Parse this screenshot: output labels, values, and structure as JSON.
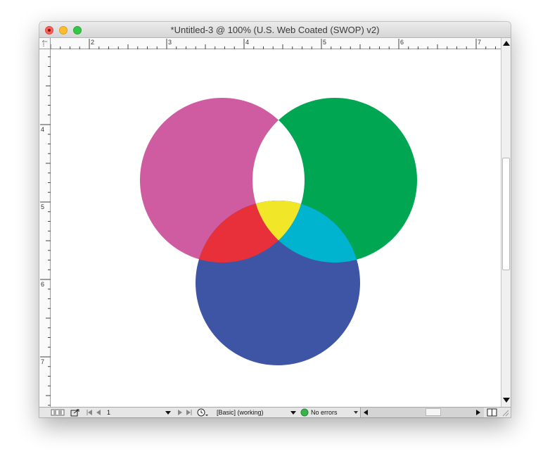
{
  "window": {
    "title": "*Untitled-3 @ 100% (U.S. Web Coated (SWOP) v2)"
  },
  "rulers": {
    "horizontal_labels": [
      "2",
      "3",
      "4",
      "5",
      "6",
      "7"
    ],
    "vertical_labels": [
      "4",
      "5",
      "6",
      "7"
    ]
  },
  "artwork": {
    "colors": {
      "magenta": "#cf5ca1",
      "green": "#00a651",
      "blue": "#3e55a5",
      "red": "#e8303a",
      "yellow": "#f2e629",
      "cyan": "#00b3ce",
      "background": "#ffffff"
    }
  },
  "status": {
    "page_number": "1",
    "profile": "[Basic] (working)",
    "preflight": "No errors",
    "preflight_color": "#3bb34a",
    "icons": [
      "view-mode-icon",
      "export-icon",
      "first-page-icon",
      "prev-page-icon",
      "next-page-icon",
      "last-page-icon",
      "clock-icon",
      "chevron-down-icon",
      "split-view-icon",
      "resize-grip-icon"
    ]
  }
}
